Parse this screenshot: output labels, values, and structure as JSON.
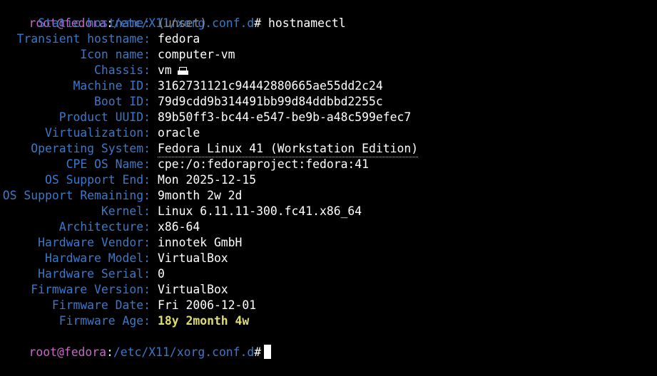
{
  "prompt": {
    "user_host": "root@fedora",
    "sep": ":",
    "path": "/etc/X11/xorg.conf.d",
    "symbol": "#",
    "command": "hostnamectl"
  },
  "rows": [
    {
      "label": "Static hostname:",
      "value": "(unset)"
    },
    {
      "label": "Transient hostname:",
      "value": "fedora"
    },
    {
      "label": "Icon name:",
      "value": "computer-vm"
    },
    {
      "label": "Chassis:",
      "value": "vm"
    },
    {
      "label": "Machine ID:",
      "value": "3162731121c94442880665ae55dd2c24"
    },
    {
      "label": "Boot ID:",
      "value": "79d9cdd9b314491bb99d84ddbbd2255c"
    },
    {
      "label": "Product UUID:",
      "value": "89b50ff3-bc44-e547-be9b-a48c599efec7"
    },
    {
      "label": "Virtualization:",
      "value": "oracle"
    },
    {
      "label": "Operating System:",
      "value": "Fedora Linux 41 (Workstation Edition)"
    },
    {
      "label": "CPE OS Name:",
      "value": "cpe:/o:fedoraproject:fedora:41"
    },
    {
      "label": "OS Support End:",
      "value": "Mon 2025-12-15"
    },
    {
      "label": "OS Support Remaining:",
      "value": "9month 2w 2d"
    },
    {
      "label": "Kernel:",
      "value": "Linux 6.11.11-300.fc41.x86_64"
    },
    {
      "label": "Architecture:",
      "value": "x86-64"
    },
    {
      "label": "Hardware Vendor:",
      "value": "innotek GmbH"
    },
    {
      "label": "Hardware Model:",
      "value": "VirtualBox"
    },
    {
      "label": "Hardware Serial:",
      "value": "0"
    },
    {
      "label": "Firmware Version:",
      "value": "VirtualBox"
    },
    {
      "label": "Firmware Date:",
      "value": "Fri 2006-12-01"
    },
    {
      "label": "Firmware Age:",
      "value": "18y 2month 4w"
    }
  ],
  "chassis_icon": "vm-chassis-icon",
  "colors": {
    "background": "#000000",
    "label": "#3b78c9",
    "user_host": "#c667c6",
    "path": "#3b78c9",
    "muted": "#8a8a8a",
    "highlight": "#dede6c",
    "text": "#ffffff"
  }
}
